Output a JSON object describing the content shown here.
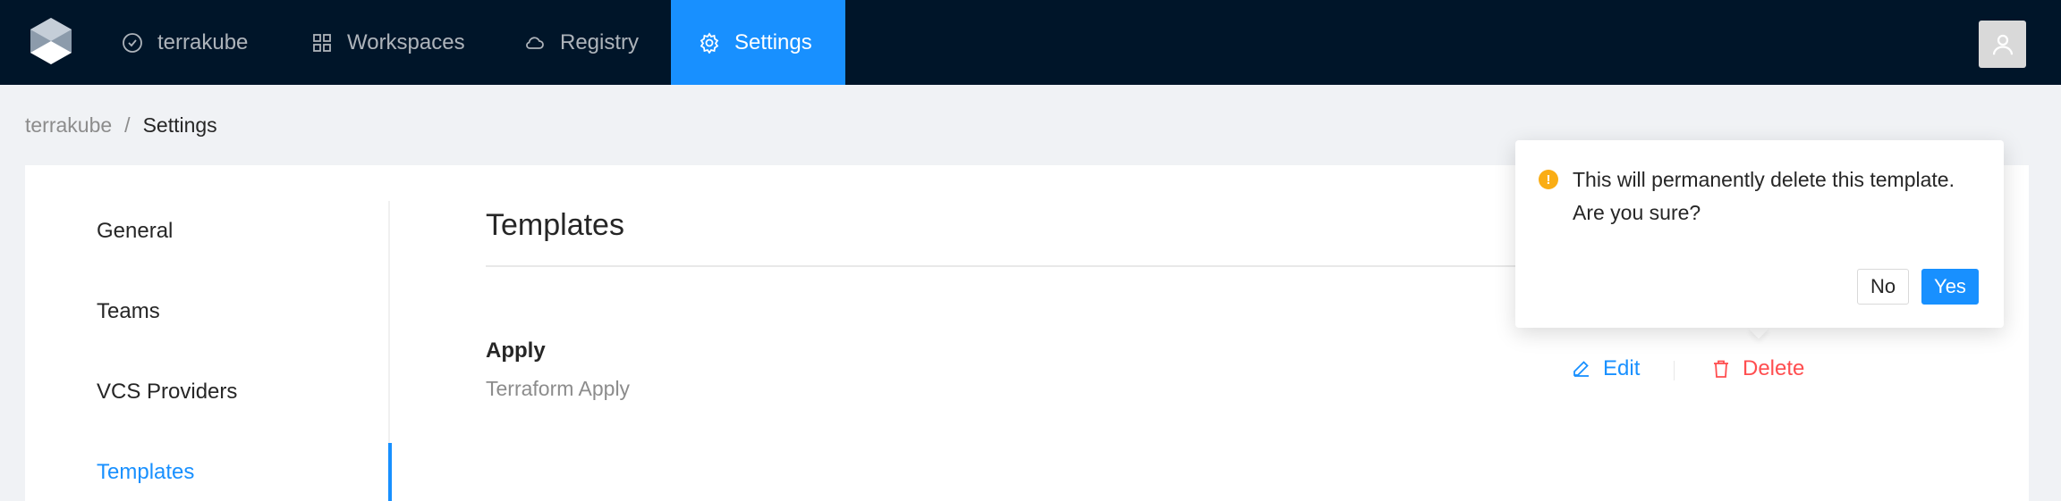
{
  "header": {
    "nav": [
      {
        "label": "terrakube",
        "icon": "circle-check-icon"
      },
      {
        "label": "Workspaces",
        "icon": "grid-icon"
      },
      {
        "label": "Registry",
        "icon": "cloud-icon"
      },
      {
        "label": "Settings",
        "icon": "gear-icon",
        "active": true
      }
    ],
    "avatar_icon": "user-icon",
    "accent_color": "#1890ff",
    "background_color": "#001529"
  },
  "breadcrumb": {
    "org": "terrakube",
    "separator": "/",
    "current": "Settings"
  },
  "sidebar": {
    "items": [
      {
        "label": "General"
      },
      {
        "label": "Teams"
      },
      {
        "label": "VCS Providers"
      },
      {
        "label": "Templates",
        "active": true
      }
    ]
  },
  "content": {
    "title": "Templates",
    "templates": [
      {
        "name": "Apply",
        "description": "Terraform Apply",
        "edit_label": "Edit",
        "delete_label": "Delete"
      }
    ]
  },
  "popconfirm": {
    "icon": "exclamation-icon",
    "line1": "This will permanently delete this template.",
    "line2": "Are you sure?",
    "no_label": "No",
    "yes_label": "Yes",
    "warning_color": "#faad14"
  }
}
